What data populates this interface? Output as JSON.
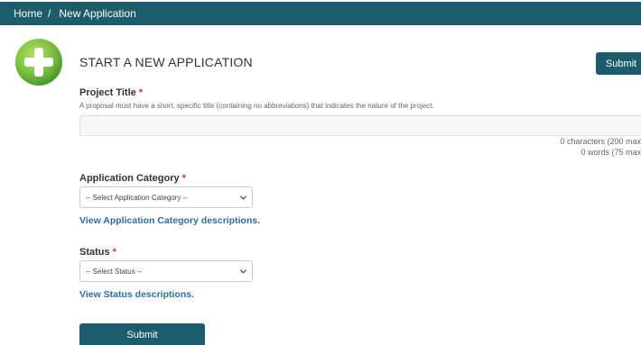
{
  "breadcrumb": {
    "home": "Home",
    "separator": "/",
    "current": "New Application"
  },
  "header": {
    "title": "START A NEW APPLICATION",
    "submit_label": "Submit",
    "icon": "plus-circle-icon"
  },
  "project_title": {
    "label": "Project Title",
    "required_mark": "*",
    "help": "A proposal must have a short, specific title (containing no abbreviations) that indicates the nature of the project.",
    "value": "",
    "char_count": "0 characters (200 max",
    "word_count": "0 words (75 max"
  },
  "category": {
    "label": "Application Category",
    "required_mark": "*",
    "selected": "-- Select Application Category --",
    "link": "View Application Category descriptions."
  },
  "status": {
    "label": "Status",
    "required_mark": "*",
    "selected": "-- Select Status --",
    "link": "View Status descriptions."
  },
  "footer": {
    "submit_label": "Submit"
  },
  "colors": {
    "primary": "#1d5c6a",
    "link": "#2d6e9e",
    "required": "#d0312d",
    "logo_green": "#7cc242"
  }
}
